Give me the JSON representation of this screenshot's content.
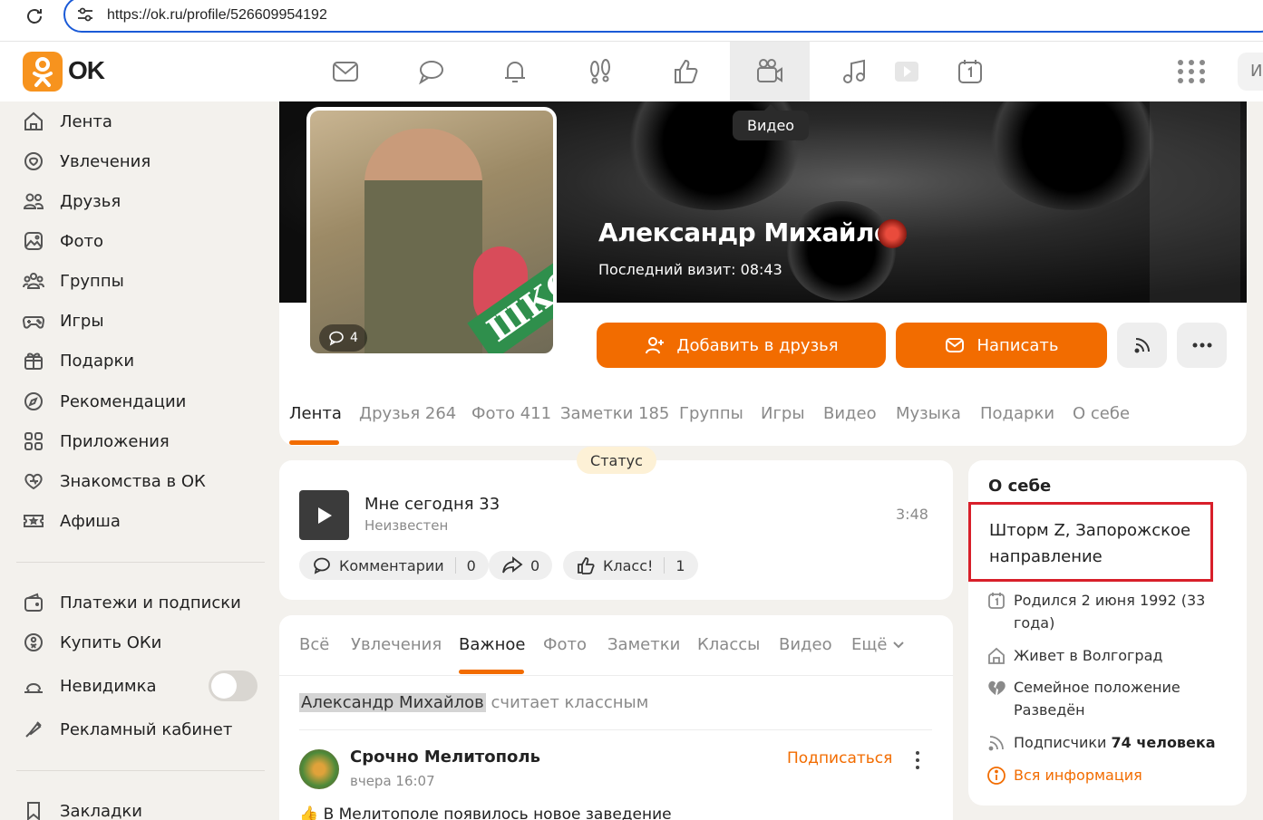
{
  "browser": {
    "url": "https://ok.ru/profile/526609954192"
  },
  "topnav": {
    "logo_text": "OK",
    "search_stub": "И",
    "active_tooltip": "Видео"
  },
  "sidebar": {
    "items": [
      {
        "label": "Лента",
        "icon": "home-icon"
      },
      {
        "label": "Увлечения",
        "icon": "hobby-icon"
      },
      {
        "label": "Друзья",
        "icon": "friends-icon"
      },
      {
        "label": "Фото",
        "icon": "photo-icon"
      },
      {
        "label": "Группы",
        "icon": "groups-icon"
      },
      {
        "label": "Игры",
        "icon": "gamepad-icon"
      },
      {
        "label": "Подарки",
        "icon": "gift-icon"
      },
      {
        "label": "Рекомендации",
        "icon": "compass-icon"
      },
      {
        "label": "Приложения",
        "icon": "apps-icon"
      },
      {
        "label": "Знакомства в ОК",
        "icon": "dating-icon"
      },
      {
        "label": "Афиша",
        "icon": "ticket-icon"
      }
    ],
    "secondary": [
      {
        "label": "Платежи и подписки",
        "icon": "wallet-icon"
      },
      {
        "label": "Купить ОКи",
        "icon": "coin-icon"
      },
      {
        "label": "Невидимка",
        "icon": "invisible-icon"
      },
      {
        "label": "Рекламный кабинет",
        "icon": "megaphone-icon"
      }
    ],
    "bottom": {
      "label": "Закладки",
      "icon": "bookmark-icon"
    },
    "invisible_toggle_on": false
  },
  "profile": {
    "name": "Александр Михайлов",
    "last_visit_label": "Последний визит:",
    "last_visit_time": "08:43",
    "avatar_comments": "4",
    "avatar_banner_text": "ШКО",
    "add_friend_label": "Добавить в друзья",
    "write_label": "Написать",
    "tabs": [
      {
        "label": "Лента",
        "active": true
      },
      {
        "label": "Друзья 264"
      },
      {
        "label": "Фото 411"
      },
      {
        "label": "Заметки 185"
      },
      {
        "label": "Группы"
      },
      {
        "label": "Игры"
      },
      {
        "label": "Видео"
      },
      {
        "label": "Музыка"
      },
      {
        "label": "Подарки"
      },
      {
        "label": "О себе"
      }
    ]
  },
  "status": {
    "pill_label": "Статус",
    "track_title": "Мне сегодня 33",
    "track_artist": "Неизвестен",
    "track_time": "3:48",
    "comments_label": "Комментарии",
    "comments_count": "0",
    "shares_count": "0",
    "likes_label": "Класс!",
    "likes_count": "1"
  },
  "feed": {
    "tabs": [
      {
        "label": "Всё"
      },
      {
        "label": "Увлечения"
      },
      {
        "label": "Важное",
        "active": true
      },
      {
        "label": "Фото"
      },
      {
        "label": "Заметки"
      },
      {
        "label": "Классы"
      },
      {
        "label": "Видео"
      },
      {
        "label": "Ещё"
      }
    ],
    "liked_name": "Александр Михайлов",
    "liked_suffix": "считает классным",
    "post_author": "Срочно Мелитополь",
    "post_time": "вчера 16:07",
    "subscribe_label": "Подписаться",
    "post_text": "👍 В Мелитополе появилось новое заведение"
  },
  "about": {
    "title": "О себе",
    "status_text": "Шторм Z, Запорожское направление",
    "born": "Родился 2 июня 1992 (33 года)",
    "lives": "Живет в Волгоград",
    "family_label": "Семейное положение",
    "family_value": "Разведён",
    "subscribers_label": "Подписчики",
    "subscribers_value": "74 человека",
    "all_info": "Вся информация"
  },
  "colors": {
    "accent": "#f26c00",
    "highlight_border": "#d81f2a",
    "url_border": "#1a5ad7"
  }
}
